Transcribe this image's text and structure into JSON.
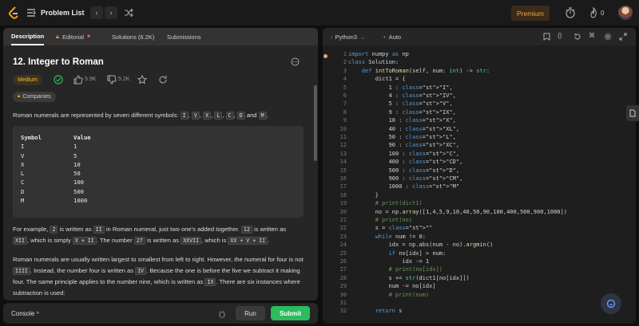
{
  "topbar": {
    "title": "Problem List",
    "premium": "Premium",
    "flame_count": "0"
  },
  "left_tabs": [
    {
      "label": "Description"
    },
    {
      "label": "Editorial"
    },
    {
      "label": "Solutions (6.2K)"
    },
    {
      "label": "Submissions"
    }
  ],
  "problem": {
    "title": "12. Integer to Roman",
    "difficulty": "Medium",
    "likes": "5.9K",
    "dislikes": "5.2K",
    "companies": "Companies",
    "intro_text": "Roman numerals are represented by seven different symbols:",
    "symbols": [
      "I",
      "V",
      "X",
      "L",
      "C",
      "D",
      "M"
    ],
    "table_header": [
      "Symbol",
      "Value"
    ],
    "table_rows": [
      [
        "I",
        "1"
      ],
      [
        "V",
        "5"
      ],
      [
        "X",
        "10"
      ],
      [
        "L",
        "50"
      ],
      [
        "C",
        "100"
      ],
      [
        "D",
        "500"
      ],
      [
        "M",
        "1000"
      ]
    ],
    "example_text": {
      "a": "For example,",
      "n2": "2",
      "b": "is written as",
      "ii": "II",
      "c": "in Roman numeral, just two one's added together.",
      "n12": "12",
      "d": "is written as",
      "xii": "XII",
      "e": ", which is simply",
      "xi": "X + II",
      "f": ". The number",
      "n27": "27",
      "g": "is written as",
      "xxvii": "XXVII",
      "h": ", which is",
      "xxvx": "XX + V + II",
      "i": "."
    },
    "para3": {
      "a": "Roman numerals are usually written largest to smallest from left to right. However, the numeral for four is not",
      "iiii": "IIII",
      "b": ". Instead, the number four is written as",
      "iv": "IV",
      "c": ". Because the one is before the five we subtract it making four. The same principle applies to the number nine, which is written as",
      "ix": "IX",
      "d": ". There are six instances where subtraction is used:"
    }
  },
  "console": {
    "label": "Console",
    "run": "Run",
    "submit": "Submit"
  },
  "editor": {
    "language": "Python3",
    "mode": "Auto"
  },
  "code_lines": [
    "import numpy as np",
    "class Solution:",
    "    def intToRoman(self, num: int) -> str:",
    "        dict1 = {",
    "            1 : \"I\",",
    "            4 : \"IV\",",
    "            5 : \"V\",",
    "            9 : \"IX\",",
    "            10 : \"X\",",
    "            40 : \"XL\",",
    "            50 : \"L\",",
    "            90 : \"XC\",",
    "            100 : \"C\",",
    "            400 : \"CD\",",
    "            500 : \"D\",",
    "            900 : \"CM\",",
    "            1000 : \"M\"",
    "        }",
    "        # print(dict1)",
    "        no = np.array([1,4,5,9,10,40,50,90,100,400,500,900,1000])",
    "        # print(no)",
    "        s = \"\"",
    "        while num != 0:",
    "            idx = np.abs(num - no).argmin()",
    "            if no[idx] > num:",
    "                idx -= 1",
    "            # print(no[idx])",
    "            s += str(dict1[no[idx]])",
    "            num -= no[idx]",
    "            # print(num)",
    "",
    "        return s"
  ]
}
